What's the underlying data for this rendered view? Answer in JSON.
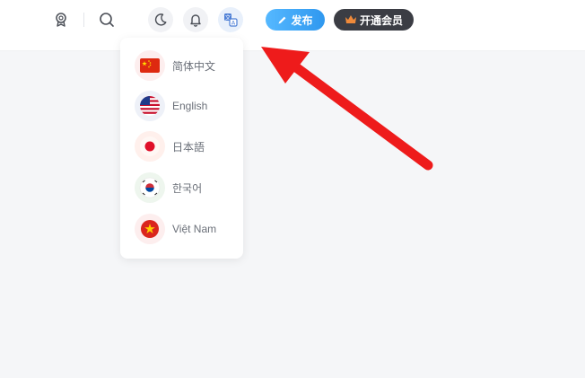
{
  "header": {
    "publish_label": "发布",
    "vip_label": "开通会员",
    "icons": [
      "award-icon",
      "search-icon",
      "moon-icon",
      "bell-icon",
      "translate-icon",
      "pencil-icon",
      "crown-icon"
    ]
  },
  "language_menu": {
    "items": [
      {
        "label": "简体中文",
        "flag": "china-flag-icon"
      },
      {
        "label": "English",
        "flag": "usa-flag-icon"
      },
      {
        "label": "日本語",
        "flag": "japan-flag-icon"
      },
      {
        "label": "한국어",
        "flag": "korea-flag-icon"
      },
      {
        "label": "Việt Nam",
        "flag": "vietnam-flag-icon"
      }
    ]
  },
  "colors": {
    "page_bg": "#f5f6f8",
    "publish_bg": "#3a9ff2",
    "vip_bg": "#3b3d44",
    "arrow": "#ee1b1b"
  }
}
